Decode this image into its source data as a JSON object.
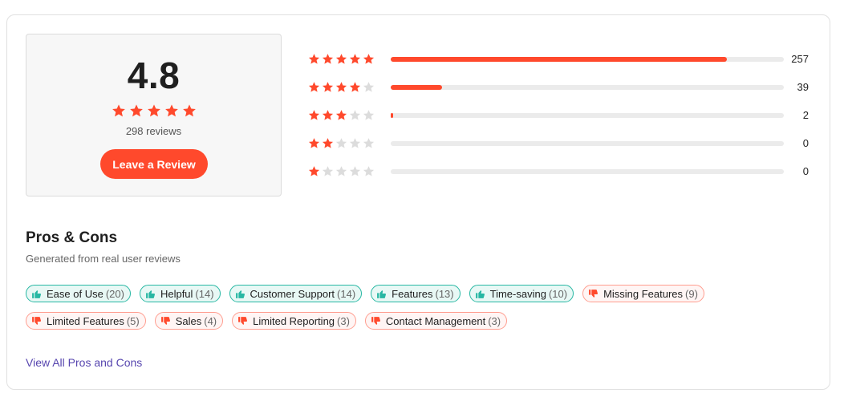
{
  "rating": {
    "average": "4.8",
    "stars_filled": 5,
    "review_count": "298 reviews",
    "leave_review_label": "Leave a Review"
  },
  "distribution": [
    {
      "stars": 5,
      "count": "257",
      "fraction": 0.855
    },
    {
      "stars": 4,
      "count": "39",
      "fraction": 0.13
    },
    {
      "stars": 3,
      "count": "2",
      "fraction": 0.007
    },
    {
      "stars": 2,
      "count": "0",
      "fraction": 0
    },
    {
      "stars": 1,
      "count": "0",
      "fraction": 0
    }
  ],
  "pros_cons": {
    "title": "Pros & Cons",
    "subtitle": "Generated from real user reviews",
    "tags": [
      {
        "label": "Ease of Use",
        "count": "(20)",
        "kind": "pro"
      },
      {
        "label": "Helpful",
        "count": "(14)",
        "kind": "pro"
      },
      {
        "label": "Customer Support",
        "count": "(14)",
        "kind": "pro"
      },
      {
        "label": "Features",
        "count": "(13)",
        "kind": "pro"
      },
      {
        "label": "Time-saving",
        "count": "(10)",
        "kind": "pro"
      },
      {
        "label": "Missing Features",
        "count": "(9)",
        "kind": "con"
      },
      {
        "label": "Limited Features",
        "count": "(5)",
        "kind": "con"
      },
      {
        "label": "Sales",
        "count": "(4)",
        "kind": "con"
      },
      {
        "label": "Limited Reporting",
        "count": "(3)",
        "kind": "con"
      },
      {
        "label": "Contact Management",
        "count": "(3)",
        "kind": "con"
      }
    ],
    "view_all_label": "View All Pros and Cons"
  },
  "colors": {
    "brand": "#ff492c",
    "star_empty": "#dcdcdc",
    "pro_icon": "#27b7a3",
    "con_icon": "#ff492c",
    "link": "#5746af"
  },
  "icons": {
    "star": "star-icon",
    "pro": "thumbs-up-icon",
    "con": "thumbs-down-icon"
  }
}
